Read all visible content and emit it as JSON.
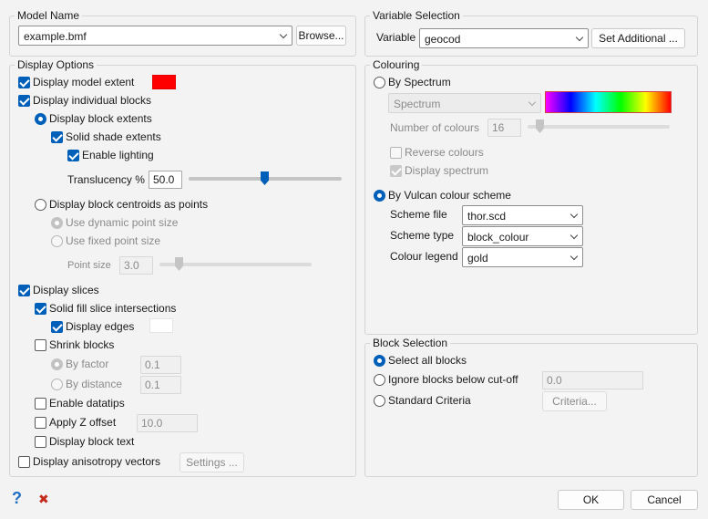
{
  "colors": {
    "accent": "#005fb8",
    "model_extent_swatch": "#ff0000",
    "display_edges_swatch": "#ffffff",
    "help_icon": "#1f6fc5",
    "close_icon": "#c42b1c"
  },
  "model_name": {
    "legend": "Model Name",
    "value": "example.bmf",
    "browse_label": "Browse..."
  },
  "variable_selection": {
    "legend": "Variable Selection",
    "label": "Variable",
    "value": "geocod",
    "set_additional_label": "Set Additional ..."
  },
  "display_options": {
    "legend": "Display Options",
    "display_model_extent": {
      "label": "Display model extent",
      "checked": true
    },
    "display_individual_blocks": {
      "label": "Display individual blocks",
      "checked": true
    },
    "display_block_extents": {
      "label": "Display block extents",
      "selected": true
    },
    "solid_shade_extents": {
      "label": "Solid shade extents",
      "checked": true
    },
    "enable_lighting": {
      "label": "Enable lighting",
      "checked": true
    },
    "translucency": {
      "label": "Translucency %",
      "value": "50.0",
      "level_percent": 50
    },
    "display_block_centroids": {
      "label": "Display block centroids as points",
      "selected": false
    },
    "use_dynamic_point_size": {
      "label": "Use dynamic point size",
      "selected": true
    },
    "use_fixed_point_size": {
      "label": "Use fixed point size",
      "selected": false
    },
    "point_size": {
      "label": "Point size",
      "value": "3.0"
    },
    "display_slices": {
      "label": "Display slices",
      "checked": true
    },
    "solid_fill_slice": {
      "label": "Solid fill slice intersections",
      "checked": true
    },
    "display_edges": {
      "label": "Display edges",
      "checked": true
    },
    "shrink_blocks": {
      "label": "Shrink blocks",
      "checked": false
    },
    "by_factor": {
      "label": "By factor",
      "value": "0.1",
      "selected": true
    },
    "by_distance": {
      "label": "By distance",
      "value": "0.1",
      "selected": false
    },
    "enable_datatips": {
      "label": "Enable datatips",
      "checked": false
    },
    "apply_z_offset": {
      "label": "Apply Z offset",
      "value": "10.0",
      "checked": false
    },
    "display_block_text": {
      "label": "Display block text",
      "checked": false
    },
    "display_anisotropy_vectors": {
      "label": "Display anisotropy vectors",
      "checked": false
    },
    "settings_label": "Settings ..."
  },
  "colouring": {
    "legend": "Colouring",
    "by_spectrum": {
      "label": "By Spectrum",
      "selected": false
    },
    "spectrum_value": "Spectrum",
    "number_of_colours": {
      "label": "Number of colours",
      "value": "16"
    },
    "reverse_colours": {
      "label": "Reverse colours",
      "checked": false
    },
    "display_spectrum": {
      "label": "Display spectrum",
      "checked": true
    },
    "by_vulcan_scheme": {
      "label": "By Vulcan colour scheme",
      "selected": true
    },
    "scheme_file": {
      "label": "Scheme file",
      "value": "thor.scd"
    },
    "scheme_type": {
      "label": "Scheme type",
      "value": "block_colour"
    },
    "colour_legend": {
      "label": "Colour legend",
      "value": "gold"
    }
  },
  "block_selection": {
    "legend": "Block Selection",
    "select_all": {
      "label": "Select all blocks",
      "selected": true
    },
    "ignore_below_cutoff": {
      "label": "Ignore blocks below cut-off",
      "value": "0.0",
      "selected": false
    },
    "standard_criteria": {
      "label": "Standard Criteria",
      "selected": false
    },
    "criteria_label": "Criteria..."
  },
  "footer": {
    "help_glyph": "?",
    "close_glyph": "✖",
    "ok_label": "OK",
    "cancel_label": "Cancel"
  }
}
